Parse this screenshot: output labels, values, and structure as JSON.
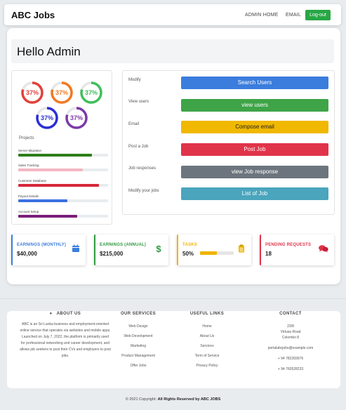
{
  "navbar": {
    "brand": "ABC Jobs",
    "links": [
      "ADMIN HOME",
      "EMAIL"
    ],
    "logout_label": "Log-out"
  },
  "greeting": "Hello Admin",
  "donuts": [
    {
      "value": "37%",
      "color": "#e3403b"
    },
    {
      "value": "37%",
      "color": "#f07a22"
    },
    {
      "value": "37%",
      "color": "#3fbf5a"
    },
    {
      "value": "37%",
      "color": "#2c2fd6"
    },
    {
      "value": "37%",
      "color": "#7c3aa8"
    }
  ],
  "projects": {
    "title": "Projects",
    "items": [
      {
        "label": "Server Migration",
        "progress": 0.82,
        "color": "#2e7d18"
      },
      {
        "label": "Sales Tracking",
        "progress": 0.72,
        "color": "#f4b6c2"
      },
      {
        "label": "Customer Database",
        "progress": 0.9,
        "color": "#d62839"
      },
      {
        "label": "Payout Details",
        "progress": 0.55,
        "color": "#3b6fe0"
      },
      {
        "label": "Account Setup",
        "progress": 0.66,
        "color": "#7b1c7b"
      }
    ]
  },
  "actions": [
    {
      "label": "Modify",
      "button": "Search Users",
      "color": "#3b7ddd",
      "text_color": "#ffffff"
    },
    {
      "label": "View users",
      "button": "view users",
      "color": "#3ea447",
      "text_color": "#ffffff"
    },
    {
      "label": "Email",
      "button": "Compose email",
      "color": "#f0b800",
      "text_color": "#222222"
    },
    {
      "label": "Post a Job",
      "button": "Post Job",
      "color": "#e0344a",
      "text_color": "#ffffff"
    },
    {
      "label": "Job responses",
      "button": "view Job response",
      "color": "#6c757d",
      "text_color": "#ffffff"
    },
    {
      "label": "Modify your jobs",
      "button": "List of Job",
      "color": "#4aa5bd",
      "text_color": "#ffffff"
    }
  ],
  "stats": [
    {
      "title": "EARNINGS (MONTHLY)",
      "value": "$40,000",
      "color": "#3b7ddd",
      "icon": "calendar-icon"
    },
    {
      "title": "EARNINGS (ANNUAL)",
      "value": "$215,000",
      "color": "#2e9a40",
      "icon": "dollar-icon"
    },
    {
      "title": "TASKS",
      "value": "50%",
      "progress": 0.5,
      "color": "#f0b400",
      "icon": "clipboard-icon"
    },
    {
      "title": "PENDING REQUESTS",
      "value": "18",
      "color": "#e0344a",
      "icon": "comments-icon"
    }
  ],
  "footer": {
    "about": {
      "heading": "ABOUT US",
      "icon": "gem-icon",
      "text": "ABC is an Sri Lanka business and employment-oriented online service that operates via websites and mobile apps. Launched on July 7, 2022, the platform is primarily used for professional networking and career development, and allows job seekers to post their CVs and employers to post jobs."
    },
    "services": {
      "heading": "OUR SERVICES",
      "items": [
        "Web Design",
        "Web Development",
        "Marketing",
        "Product Management",
        "Offer Jobs"
      ]
    },
    "links": {
      "heading": "USEFUL LINKS",
      "items": [
        "Home",
        "About Us",
        "Services",
        "Term of Service",
        "Privacy Policy"
      ]
    },
    "contact": {
      "heading": "CONTACT",
      "address": [
        "23/8",
        "Virtusa Road",
        "Colombo 8"
      ],
      "email": "portalabcjobs@example.com",
      "phones": [
        "+ 94 782269976",
        "+ 94 760528233"
      ]
    }
  },
  "copyright": {
    "prefix": "© 2021 Copyright:",
    "bold": "All Rights Reserved by ABC JOBS"
  }
}
